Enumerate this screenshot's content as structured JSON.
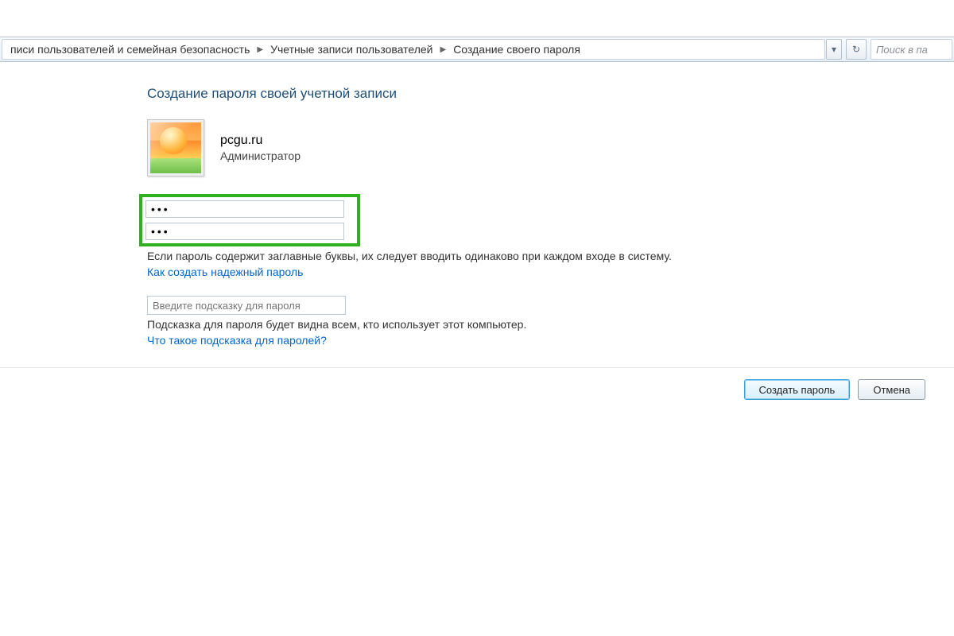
{
  "breadcrumb": [
    "писи пользователей и семейная безопасность",
    "Учетные записи пользователей",
    "Создание своего пароля"
  ],
  "search": {
    "placeholder": "Поиск в па"
  },
  "page": {
    "title": "Создание пароля своей учетной записи"
  },
  "user": {
    "name": "pcgu.ru",
    "role": "Администратор"
  },
  "passwords": {
    "new": "•••",
    "confirm": "•••"
  },
  "texts": {
    "caps_warning": "Если пароль содержит заглавные буквы, их следует вводить одинаково при каждом входе в систему.",
    "hint_visibility": "Подсказка для пароля будет видна всем, кто использует этот компьютер."
  },
  "links": {
    "strong_password": "Как создать надежный пароль",
    "what_is_hint": "Что такое подсказка для паролей?"
  },
  "hint": {
    "placeholder": "Введите подсказку для пароля"
  },
  "buttons": {
    "create": "Создать пароль",
    "cancel": "Отмена"
  }
}
